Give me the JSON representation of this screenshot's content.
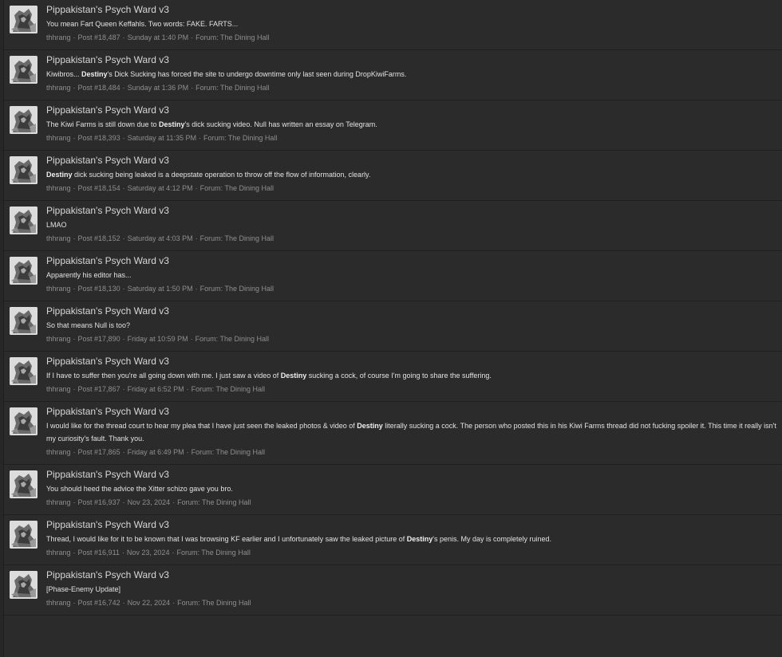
{
  "results": [
    {
      "title": "Pippakistan's Psych Ward v3",
      "snippet": [
        {
          "text": "You mean Fart Queen Keffahls. Two words: FAKE. FARTS...",
          "bold": false
        }
      ],
      "author": "thhrang",
      "post": "Post #18,487",
      "date": "Sunday at 1:40 PM",
      "forum": "Forum: The Dining Hall"
    },
    {
      "title": "Pippakistan's Psych Ward v3",
      "snippet": [
        {
          "text": "Kiwibros... ",
          "bold": false
        },
        {
          "text": "Destiny",
          "bold": true
        },
        {
          "text": "'s Dick Sucking has forced the site to undergo downtime only last seen during DropKiwiFarms.",
          "bold": false
        }
      ],
      "author": "thhrang",
      "post": "Post #18,484",
      "date": "Sunday at 1:36 PM",
      "forum": "Forum: The Dining Hall"
    },
    {
      "title": "Pippakistan's Psych Ward v3",
      "snippet": [
        {
          "text": "The Kiwi Farms is still down due to ",
          "bold": false
        },
        {
          "text": "Destiny",
          "bold": true
        },
        {
          "text": "'s dick sucking video. Null has written an essay on Telegram.",
          "bold": false
        }
      ],
      "author": "thhrang",
      "post": "Post #18,393",
      "date": "Saturday at 11:35 PM",
      "forum": "Forum: The Dining Hall"
    },
    {
      "title": "Pippakistan's Psych Ward v3",
      "snippet": [
        {
          "text": "Destiny",
          "bold": true
        },
        {
          "text": " dick sucking being leaked is a deepstate operation to throw off the flow of information, clearly.",
          "bold": false
        }
      ],
      "author": "thhrang",
      "post": "Post #18,154",
      "date": "Saturday at 4:12 PM",
      "forum": "Forum: The Dining Hall"
    },
    {
      "title": "Pippakistan's Psych Ward v3",
      "snippet": [
        {
          "text": "LMAO",
          "bold": false
        }
      ],
      "author": "thhrang",
      "post": "Post #18,152",
      "date": "Saturday at 4:03 PM",
      "forum": "Forum: The Dining Hall"
    },
    {
      "title": "Pippakistan's Psych Ward v3",
      "snippet": [
        {
          "text": "Apparently his editor has...",
          "bold": false
        }
      ],
      "author": "thhrang",
      "post": "Post #18,130",
      "date": "Saturday at 1:50 PM",
      "forum": "Forum: The Dining Hall"
    },
    {
      "title": "Pippakistan's Psych Ward v3",
      "snippet": [
        {
          "text": "So that means Null is too?",
          "bold": false
        }
      ],
      "author": "thhrang",
      "post": "Post #17,890",
      "date": "Friday at 10:59 PM",
      "forum": "Forum: The Dining Hall"
    },
    {
      "title": "Pippakistan's Psych Ward v3",
      "snippet": [
        {
          "text": "If I have to suffer then you're all going down with me. I just saw a video of ",
          "bold": false
        },
        {
          "text": "Destiny",
          "bold": true
        },
        {
          "text": " sucking a cock, of course I'm going to share the suffering.",
          "bold": false
        }
      ],
      "author": "thhrang",
      "post": "Post #17,867",
      "date": "Friday at 6:52 PM",
      "forum": "Forum: The Dining Hall"
    },
    {
      "title": "Pippakistan's Psych Ward v3",
      "snippet": [
        {
          "text": "I would like for the thread court to hear my plea that I have just seen the leaked photos & video of ",
          "bold": false
        },
        {
          "text": "Destiny",
          "bold": true
        },
        {
          "text": " literally sucking a cock. The person who posted this in his Kiwi Farms thread did not fucking spoiler it. This time it really isn't my curiosity's fault. Thank you.",
          "bold": false
        }
      ],
      "author": "thhrang",
      "post": "Post #17,865",
      "date": "Friday at 6:49 PM",
      "forum": "Forum: The Dining Hall"
    },
    {
      "title": "Pippakistan's Psych Ward v3",
      "snippet": [
        {
          "text": "You should heed the advice the Xitter schizo gave you bro.",
          "bold": false
        }
      ],
      "author": "thhrang",
      "post": "Post #16,937",
      "date": "Nov 23, 2024",
      "forum": "Forum: The Dining Hall"
    },
    {
      "title": "Pippakistan's Psych Ward v3",
      "snippet": [
        {
          "text": "Thread, I would like for it to be known that I was browsing KF earlier and I unfortunately saw the leaked picture of ",
          "bold": false
        },
        {
          "text": "Destiny",
          "bold": true
        },
        {
          "text": "'s penis. My day is completely ruined.",
          "bold": false
        }
      ],
      "author": "thhrang",
      "post": "Post #16,911",
      "date": "Nov 23, 2024",
      "forum": "Forum: The Dining Hall"
    },
    {
      "title": "Pippakistan's Psych Ward v3",
      "snippet": [
        {
          "text": "[Phase-Enemy Update]",
          "bold": false
        }
      ],
      "author": "thhrang",
      "post": "Post #16,742",
      "date": "Nov 22, 2024",
      "forum": "Forum: The Dining Hall"
    }
  ],
  "meta_separator": "·",
  "icons": {
    "avatar": "user-avatar-icon"
  }
}
